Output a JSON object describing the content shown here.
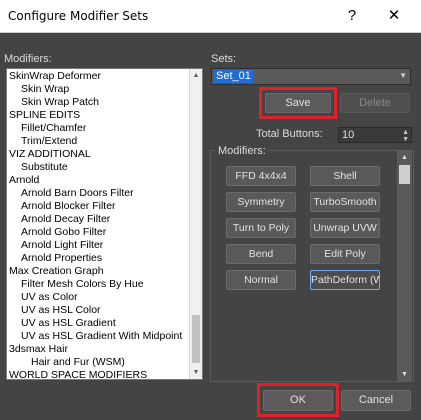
{
  "window": {
    "title": "Configure Modifier Sets",
    "help": "?",
    "close": "✕"
  },
  "left": {
    "label": "Modifiers:",
    "items": [
      "SkinWrap Deformer",
      "Skin Wrap",
      "Skin Wrap Patch",
      "SPLINE EDITS",
      "Fillet/Chamfer",
      "Trim/Extend",
      "VIZ ADDITIONAL",
      "Substitute",
      "Arnold",
      "Arnold Barn Doors Filter",
      "Arnold Blocker Filter",
      "Arnold Decay Filter",
      "Arnold Gobo Filter",
      "Arnold Light Filter",
      "Arnold Properties",
      "Max Creation Graph",
      "Filter Mesh Colors By Hue",
      "UV as Color",
      "UV as HSL Color",
      "UV as HSL Gradient",
      "UV as HSL Gradient With Midpoint",
      "3dsmax Hair",
      "Hair and Fur (WSM)",
      "WORLD SPACE MODIFIERS"
    ]
  },
  "sets": {
    "label": "Sets:",
    "value": "Set_01",
    "save": "Save",
    "delete": "Delete",
    "total_label": "Total Buttons:",
    "total_value": "10"
  },
  "modifiers": {
    "label": "Modifiers:",
    "buttons": [
      "FFD 4x4x4",
      "Shell",
      "Symmetry",
      "TurboSmooth",
      "Turn to Poly",
      "Unwrap UVW",
      "Bend",
      "Edit Poly",
      "Normal",
      "PathDeform (W"
    ]
  },
  "footer": {
    "ok": "OK",
    "cancel": "Cancel"
  },
  "colors": {
    "highlight": "#e0202a",
    "selection": "#1f6ed4"
  }
}
